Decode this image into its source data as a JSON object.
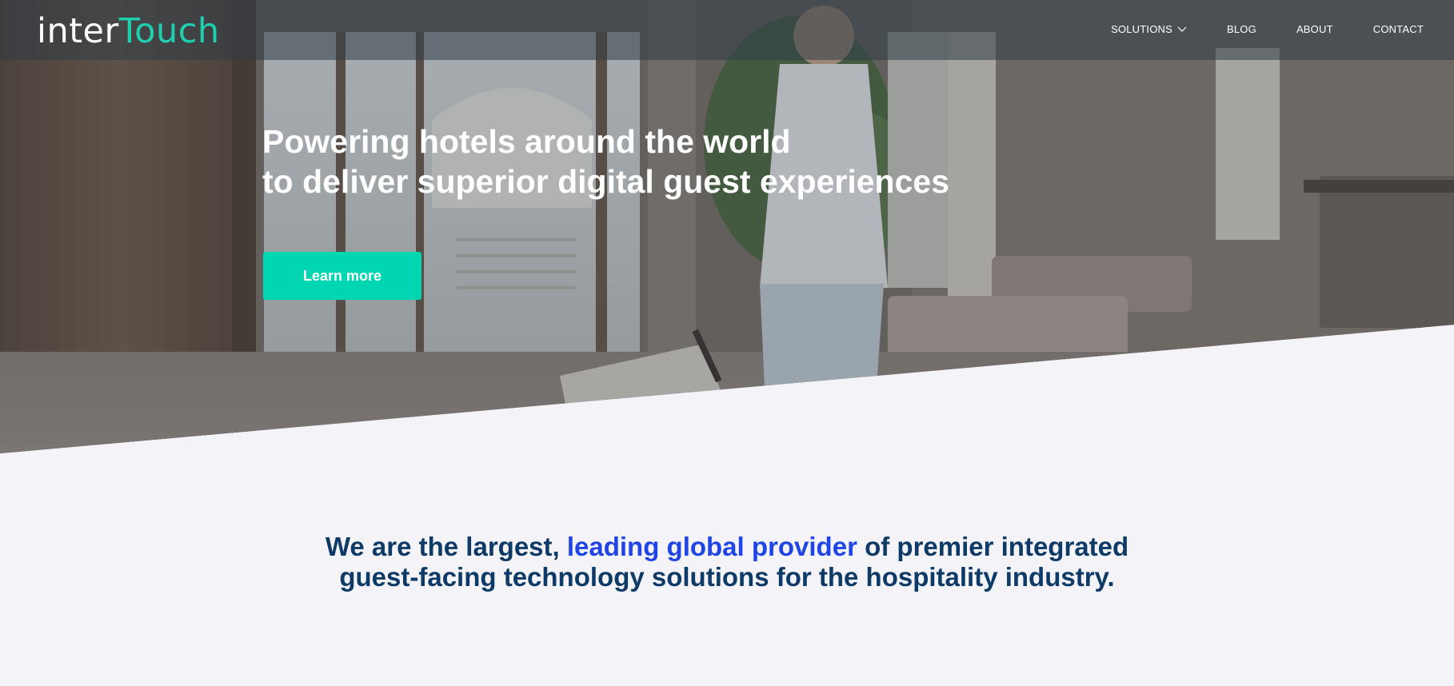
{
  "header": {
    "logo": {
      "part1": "inter",
      "part2": "Touch"
    },
    "nav": [
      {
        "label": "SOLUTIONS",
        "icon": "chevron-down-icon"
      },
      {
        "label": "BLOG"
      },
      {
        "label": "ABOUT"
      },
      {
        "label": "CONTACT"
      }
    ]
  },
  "hero": {
    "title_line1": "Powering hotels around the world",
    "title_line2": "to deliver superior digital guest experiences",
    "cta_label": "Learn more",
    "background_image": "hotel-lobby-man-with-suitcase"
  },
  "intro": {
    "text_before": "We are the largest, ",
    "highlight": "leading global provider",
    "text_after_line1": " of premier integrated",
    "text_line2": "guest-facing technology solutions for the hospitality industry."
  },
  "colors": {
    "accent": "#00d7b2",
    "logo_accent": "#1ecfb0",
    "heading_text": "#0d3a66",
    "highlight_text": "#1f45e6",
    "page_background": "#f3f3f8"
  }
}
